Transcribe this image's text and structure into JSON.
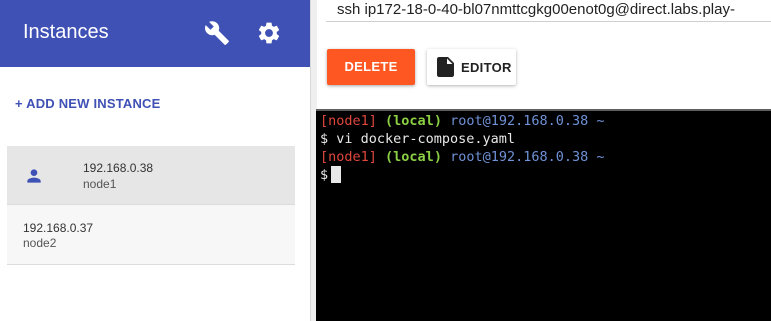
{
  "sidebar": {
    "title": "Instances",
    "icons": [
      "wrench-icon",
      "gear-icon"
    ],
    "add_instance_label": "+ ADD NEW INSTANCE",
    "instances": [
      {
        "ip": "192.168.0.38",
        "name": "node1",
        "selected": true,
        "icon": "person-icon"
      },
      {
        "ip": "192.168.0.37",
        "name": "node2",
        "selected": false
      }
    ]
  },
  "main": {
    "ssh_command": "ssh ip172-18-0-40-bl07nmttcgkg00enot0g@direct.labs.play-",
    "delete_label": "DELETE",
    "editor_label": "EDITOR",
    "editor_icon": "file-icon"
  },
  "terminal": {
    "lines": [
      {
        "node": "[node1]",
        "local": "(local)",
        "user": "root@192.168.0.38 ~"
      },
      {
        "prompt": "$ vi docker-compose.yaml"
      },
      {
        "node": "[node1]",
        "local": "(local)",
        "user": "root@192.168.0.38 ~"
      },
      {
        "prompt": "$"
      }
    ]
  },
  "colors": {
    "header_bg": "#3f51b5",
    "accent": "#3f51b5",
    "delete_bg": "#ff5722",
    "terminal_bg": "#000000",
    "term_node": "#e0473c",
    "term_local": "#8bd044",
    "term_user": "#6f91d6"
  }
}
